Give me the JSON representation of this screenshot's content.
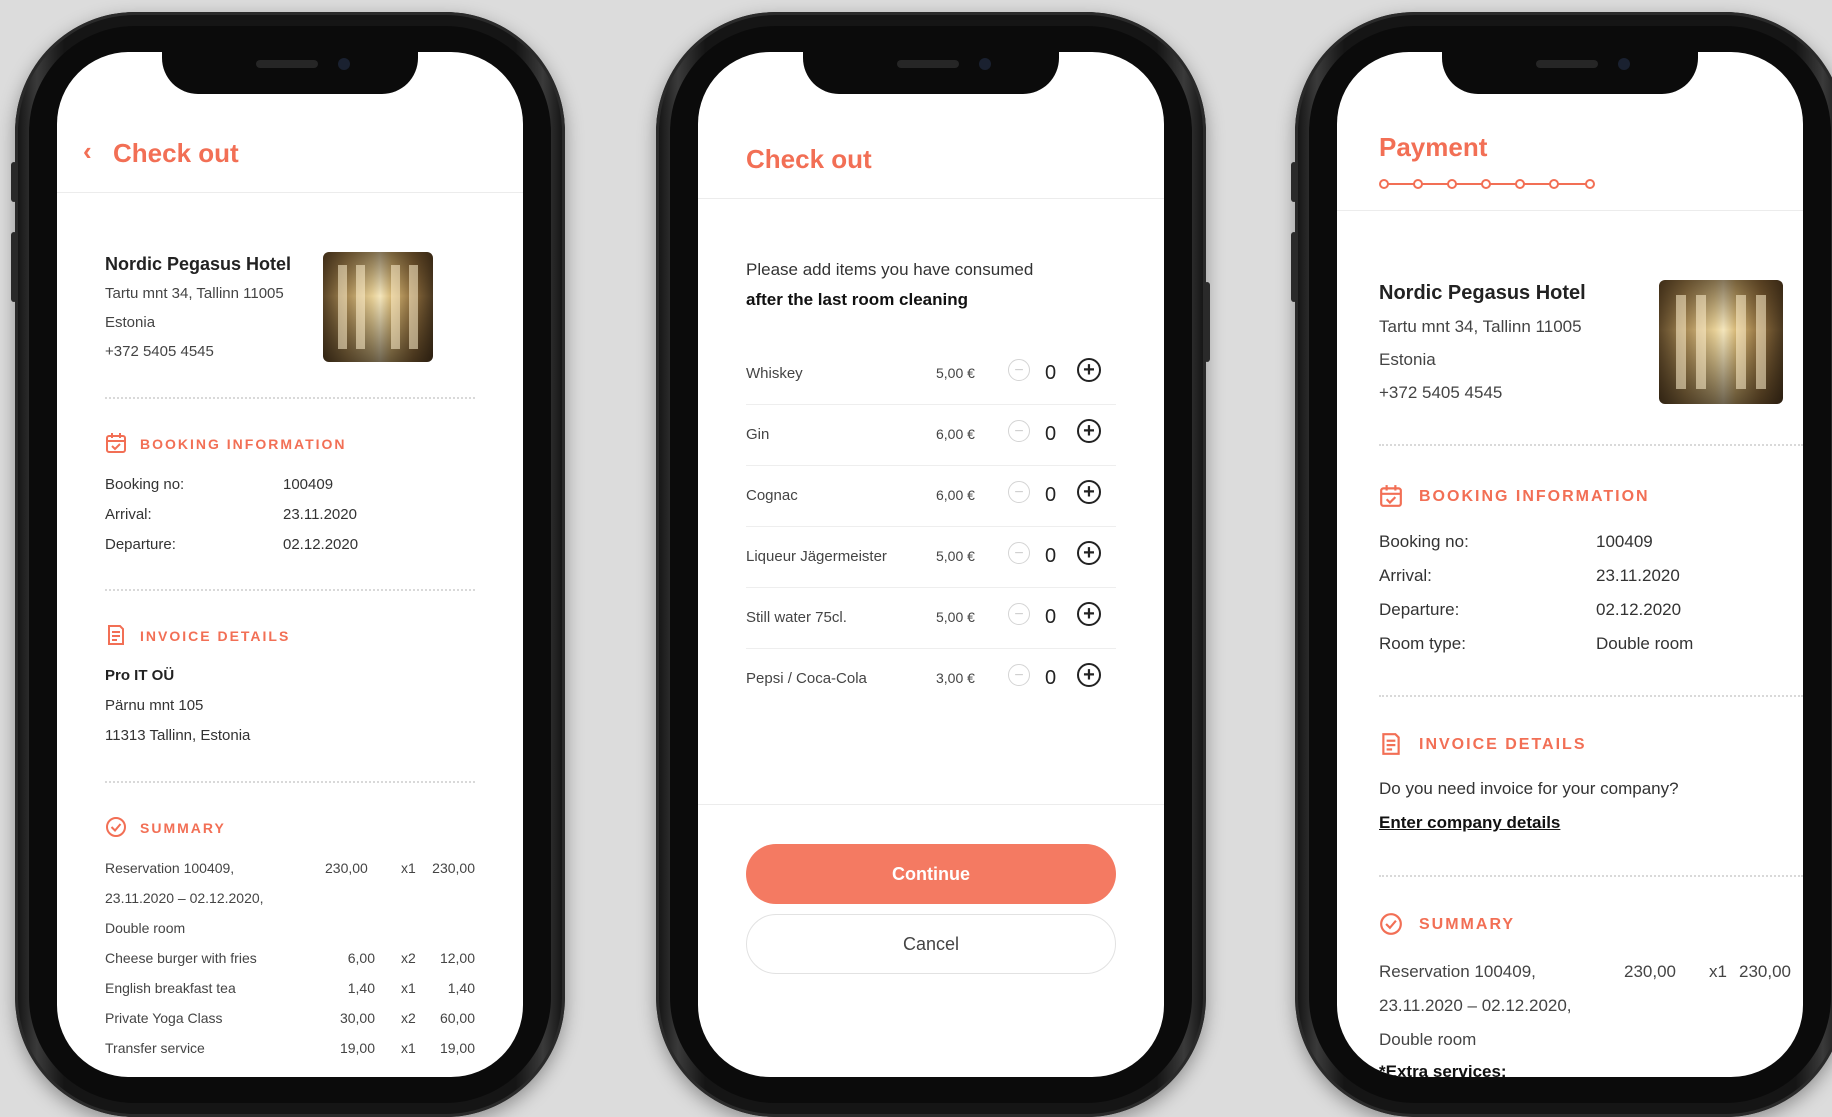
{
  "colors": {
    "accent": "#f26f55",
    "button": "#f47a62",
    "background": "#dcdcdc"
  },
  "screen1": {
    "back_icon": "‹",
    "title": "Check out",
    "hotel": {
      "name": "Nordic Pegasus Hotel",
      "address": "Tartu mnt 34, Tallinn 11005",
      "country": "Estonia",
      "phone": "+372 5405 4545"
    },
    "booking": {
      "title": "BOOKING INFORMATION",
      "rows": [
        {
          "label": "Booking no:",
          "value": "100409"
        },
        {
          "label": "Arrival:",
          "value": "23.11.2020"
        },
        {
          "label": "Departure:",
          "value": "02.12.2020"
        }
      ]
    },
    "invoice": {
      "title": "INVOICE DETAILS",
      "company": "Pro IT OÜ",
      "street": "Pärnu mnt 105",
      "city": "11313 Tallinn, Estonia"
    },
    "summary": {
      "title": "SUMMARY",
      "reservation": {
        "line1": "Reservation 100409,",
        "line2": "23.11.2020 – 02.12.2020,",
        "line3": "Double room",
        "price": "230,00",
        "qty": "x1",
        "total": "230,00"
      },
      "items": [
        {
          "name": "Cheese burger with fries",
          "price": "6,00",
          "qty": "x2",
          "total": "12,00"
        },
        {
          "name": "English breakfast tea",
          "price": "1,40",
          "qty": "x1",
          "total": "1,40"
        },
        {
          "name": "Private Yoga Class",
          "price": "30,00",
          "qty": "x2",
          "total": "60,00"
        },
        {
          "name": "Transfer service",
          "price": "19,00",
          "qty": "x1",
          "total": "19,00"
        }
      ]
    }
  },
  "screen2": {
    "title": "Check out",
    "intro": "Please add items you have consumed",
    "intro_bold": "after the last room cleaning",
    "items": [
      {
        "name": "Whiskey",
        "price": "5,00 €",
        "qty": "0"
      },
      {
        "name": "Gin",
        "price": "6,00 €",
        "qty": "0"
      },
      {
        "name": "Cognac",
        "price": "6,00 €",
        "qty": "0"
      },
      {
        "name": "Liqueur Jägermeister",
        "price": "5,00 €",
        "qty": "0"
      },
      {
        "name": "Still water 75cl.",
        "price": "5,00 €",
        "qty": "0"
      },
      {
        "name": "Pepsi / Coca-Cola",
        "price": "3,00 €",
        "qty": "0"
      }
    ],
    "minus_icon": "−",
    "plus_icon": "+",
    "continue_label": "Continue",
    "cancel_label": "Cancel"
  },
  "screen3": {
    "title": "Payment",
    "hotel": {
      "name": "Nordic Pegasus Hotel",
      "address": "Tartu mnt 34, Tallinn 11005",
      "country": "Estonia",
      "phone": "+372 5405 4545"
    },
    "booking": {
      "title": "BOOKING INFORMATION",
      "rows": [
        {
          "label": "Booking no:",
          "value": "100409"
        },
        {
          "label": "Arrival:",
          "value": "23.11.2020"
        },
        {
          "label": "Departure:",
          "value": "02.12.2020"
        },
        {
          "label": "Room type:",
          "value": "Double room"
        }
      ]
    },
    "invoice": {
      "title": "INVOICE DETAILS",
      "question": "Do you need invoice for your company?",
      "link": "Enter company details"
    },
    "summary": {
      "title": "SUMMARY",
      "reservation": {
        "line1": "Reservation 100409,",
        "line2": "23.11.2020 – 02.12.2020,",
        "line3": "Double room",
        "price": "230,00",
        "qty": "x1",
        "total": "230,00"
      },
      "extra": "*Extra services:"
    }
  }
}
